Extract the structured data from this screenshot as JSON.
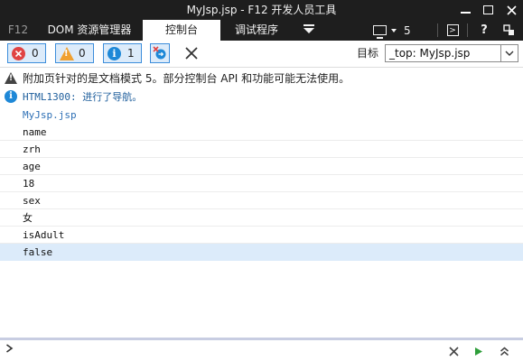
{
  "window": {
    "title": "MyJsp.jsp - F12 开发人员工具"
  },
  "tabs": {
    "f12": "F12",
    "dom": "DOM 资源管理器",
    "console": "控制台",
    "debugger": "调试程序",
    "emulation_count": "5",
    "help": "?"
  },
  "toolbar": {
    "error_count": "0",
    "warning_count": "0",
    "info_count": "1",
    "target_label": "目标",
    "target_value": "_top: MyJsp.jsp"
  },
  "messages": {
    "warning": "附加页针对的是文档模式 5。部分控制台 API 和功能可能无法使用。",
    "info": "HTML1300: 进行了导航。",
    "source": "MyJsp.jsp"
  },
  "log_lines": [
    "name",
    "zrh",
    "age",
    "18",
    "sex",
    "女",
    "isAdult",
    "false"
  ],
  "colors": {
    "chrome": "#1e1e1e",
    "accent": "#1e88d7",
    "error": "#e04343",
    "warning": "#f0a030",
    "selected_row": "#dcebfa",
    "run": "#2e9e3a"
  },
  "icons": {
    "error": "error-circle-icon",
    "warning": "warning-triangle-icon",
    "info": "info-circle-icon",
    "clear_on_navigate": "clear-on-navigate-icon",
    "clear": "clear-console-icon"
  }
}
